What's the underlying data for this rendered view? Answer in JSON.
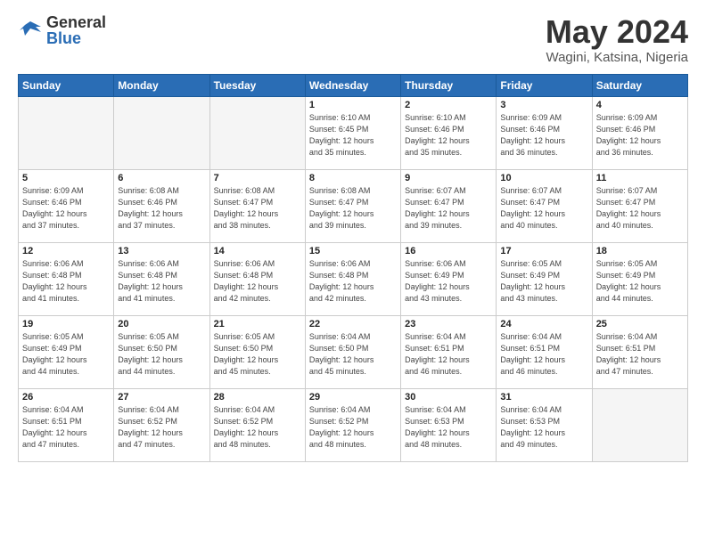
{
  "logo": {
    "general": "General",
    "blue": "Blue"
  },
  "calendar": {
    "title": "May 2024",
    "subtitle": "Wagini, Katsina, Nigeria",
    "headers": [
      "Sunday",
      "Monday",
      "Tuesday",
      "Wednesday",
      "Thursday",
      "Friday",
      "Saturday"
    ],
    "rows": [
      [
        {
          "day": "",
          "info": "",
          "empty": true
        },
        {
          "day": "",
          "info": "",
          "empty": true
        },
        {
          "day": "",
          "info": "",
          "empty": true
        },
        {
          "day": "1",
          "info": "Sunrise: 6:10 AM\nSunset: 6:45 PM\nDaylight: 12 hours\nand 35 minutes."
        },
        {
          "day": "2",
          "info": "Sunrise: 6:10 AM\nSunset: 6:46 PM\nDaylight: 12 hours\nand 35 minutes."
        },
        {
          "day": "3",
          "info": "Sunrise: 6:09 AM\nSunset: 6:46 PM\nDaylight: 12 hours\nand 36 minutes."
        },
        {
          "day": "4",
          "info": "Sunrise: 6:09 AM\nSunset: 6:46 PM\nDaylight: 12 hours\nand 36 minutes."
        }
      ],
      [
        {
          "day": "5",
          "info": "Sunrise: 6:09 AM\nSunset: 6:46 PM\nDaylight: 12 hours\nand 37 minutes."
        },
        {
          "day": "6",
          "info": "Sunrise: 6:08 AM\nSunset: 6:46 PM\nDaylight: 12 hours\nand 37 minutes."
        },
        {
          "day": "7",
          "info": "Sunrise: 6:08 AM\nSunset: 6:47 PM\nDaylight: 12 hours\nand 38 minutes."
        },
        {
          "day": "8",
          "info": "Sunrise: 6:08 AM\nSunset: 6:47 PM\nDaylight: 12 hours\nand 39 minutes."
        },
        {
          "day": "9",
          "info": "Sunrise: 6:07 AM\nSunset: 6:47 PM\nDaylight: 12 hours\nand 39 minutes."
        },
        {
          "day": "10",
          "info": "Sunrise: 6:07 AM\nSunset: 6:47 PM\nDaylight: 12 hours\nand 40 minutes."
        },
        {
          "day": "11",
          "info": "Sunrise: 6:07 AM\nSunset: 6:47 PM\nDaylight: 12 hours\nand 40 minutes."
        }
      ],
      [
        {
          "day": "12",
          "info": "Sunrise: 6:06 AM\nSunset: 6:48 PM\nDaylight: 12 hours\nand 41 minutes."
        },
        {
          "day": "13",
          "info": "Sunrise: 6:06 AM\nSunset: 6:48 PM\nDaylight: 12 hours\nand 41 minutes."
        },
        {
          "day": "14",
          "info": "Sunrise: 6:06 AM\nSunset: 6:48 PM\nDaylight: 12 hours\nand 42 minutes."
        },
        {
          "day": "15",
          "info": "Sunrise: 6:06 AM\nSunset: 6:48 PM\nDaylight: 12 hours\nand 42 minutes."
        },
        {
          "day": "16",
          "info": "Sunrise: 6:06 AM\nSunset: 6:49 PM\nDaylight: 12 hours\nand 43 minutes."
        },
        {
          "day": "17",
          "info": "Sunrise: 6:05 AM\nSunset: 6:49 PM\nDaylight: 12 hours\nand 43 minutes."
        },
        {
          "day": "18",
          "info": "Sunrise: 6:05 AM\nSunset: 6:49 PM\nDaylight: 12 hours\nand 44 minutes."
        }
      ],
      [
        {
          "day": "19",
          "info": "Sunrise: 6:05 AM\nSunset: 6:49 PM\nDaylight: 12 hours\nand 44 minutes."
        },
        {
          "day": "20",
          "info": "Sunrise: 6:05 AM\nSunset: 6:50 PM\nDaylight: 12 hours\nand 44 minutes."
        },
        {
          "day": "21",
          "info": "Sunrise: 6:05 AM\nSunset: 6:50 PM\nDaylight: 12 hours\nand 45 minutes."
        },
        {
          "day": "22",
          "info": "Sunrise: 6:04 AM\nSunset: 6:50 PM\nDaylight: 12 hours\nand 45 minutes."
        },
        {
          "day": "23",
          "info": "Sunrise: 6:04 AM\nSunset: 6:51 PM\nDaylight: 12 hours\nand 46 minutes."
        },
        {
          "day": "24",
          "info": "Sunrise: 6:04 AM\nSunset: 6:51 PM\nDaylight: 12 hours\nand 46 minutes."
        },
        {
          "day": "25",
          "info": "Sunrise: 6:04 AM\nSunset: 6:51 PM\nDaylight: 12 hours\nand 47 minutes."
        }
      ],
      [
        {
          "day": "26",
          "info": "Sunrise: 6:04 AM\nSunset: 6:51 PM\nDaylight: 12 hours\nand 47 minutes."
        },
        {
          "day": "27",
          "info": "Sunrise: 6:04 AM\nSunset: 6:52 PM\nDaylight: 12 hours\nand 47 minutes."
        },
        {
          "day": "28",
          "info": "Sunrise: 6:04 AM\nSunset: 6:52 PM\nDaylight: 12 hours\nand 48 minutes."
        },
        {
          "day": "29",
          "info": "Sunrise: 6:04 AM\nSunset: 6:52 PM\nDaylight: 12 hours\nand 48 minutes."
        },
        {
          "day": "30",
          "info": "Sunrise: 6:04 AM\nSunset: 6:53 PM\nDaylight: 12 hours\nand 48 minutes."
        },
        {
          "day": "31",
          "info": "Sunrise: 6:04 AM\nSunset: 6:53 PM\nDaylight: 12 hours\nand 49 minutes."
        },
        {
          "day": "",
          "info": "",
          "empty": true
        }
      ]
    ]
  }
}
